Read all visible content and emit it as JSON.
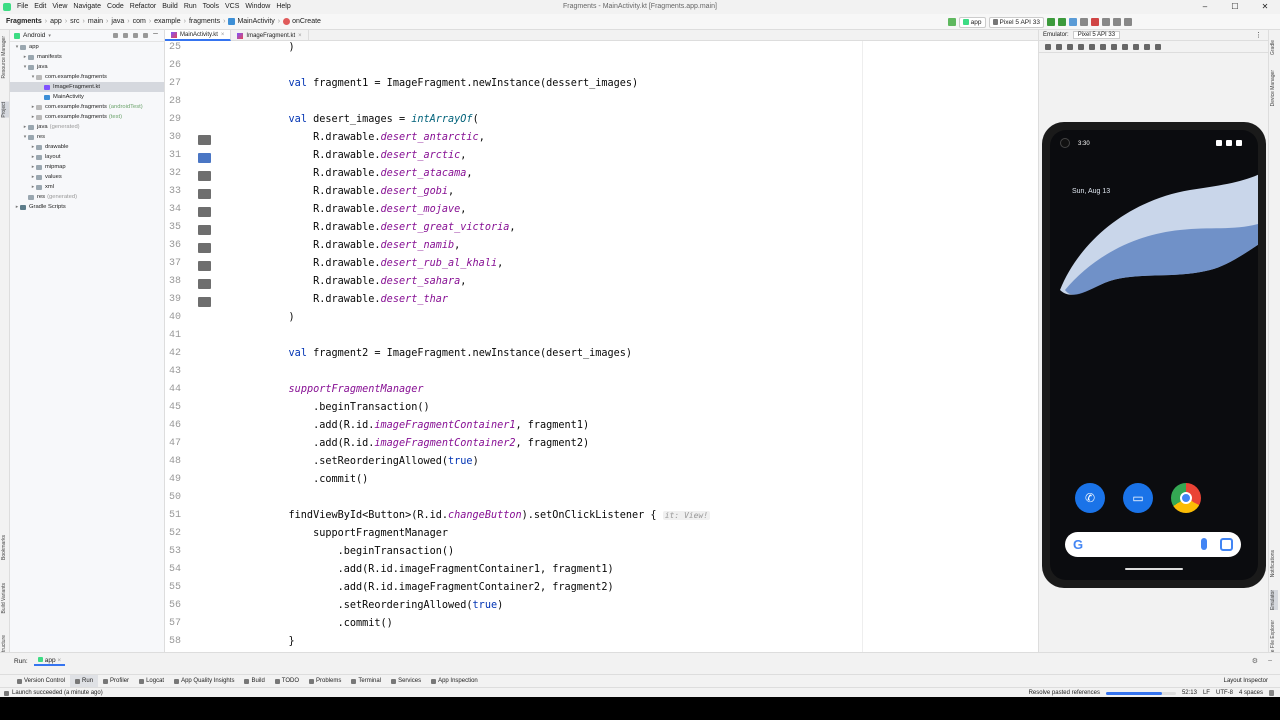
{
  "window": {
    "title": "Fragments - MainActivity.kt [Fragments.app.main]",
    "menu": [
      "File",
      "Edit",
      "View",
      "Navigate",
      "Code",
      "Refactor",
      "Build",
      "Run",
      "Tools",
      "VCS",
      "Window",
      "Help"
    ]
  },
  "breadcrumb": [
    "Fragments",
    "app",
    "src",
    "main",
    "java",
    "com",
    "example",
    "fragments",
    "MainActivity",
    "onCreate"
  ],
  "toolbar": {
    "run_config": "app",
    "device": "Pixel 5 API 33"
  },
  "project": {
    "view_mode": "Android",
    "tree": [
      {
        "label": "app",
        "indent": 0,
        "fold": "open",
        "icon": "folder-icon"
      },
      {
        "label": "manifests",
        "indent": 1,
        "fold": "closed",
        "icon": "folder-icon"
      },
      {
        "label": "java",
        "indent": 1,
        "fold": "open",
        "icon": "folder-icon"
      },
      {
        "label": "com.example.fragments",
        "indent": 2,
        "fold": "open",
        "icon": "package-icon"
      },
      {
        "label": "ImageFragment.kt",
        "indent": 3,
        "fold": "",
        "icon": "kotlin-file-icon",
        "selected": true
      },
      {
        "label": "MainActivity",
        "indent": 3,
        "fold": "",
        "icon": "kotlin-class-icon"
      },
      {
        "label": "com.example.fragments",
        "indent": 2,
        "fold": "closed",
        "icon": "package-icon",
        "suffix": "(androidTest)"
      },
      {
        "label": "com.example.fragments",
        "indent": 2,
        "fold": "closed",
        "icon": "package-icon",
        "suffix": "(test)"
      },
      {
        "label": "java",
        "indent": 1,
        "fold": "closed",
        "icon": "folder-icon",
        "gen": "(generated)"
      },
      {
        "label": "res",
        "indent": 1,
        "fold": "open",
        "icon": "folder-icon"
      },
      {
        "label": "drawable",
        "indent": 2,
        "fold": "closed",
        "icon": "folder-icon"
      },
      {
        "label": "layout",
        "indent": 2,
        "fold": "closed",
        "icon": "folder-icon"
      },
      {
        "label": "mipmap",
        "indent": 2,
        "fold": "closed",
        "icon": "folder-icon"
      },
      {
        "label": "values",
        "indent": 2,
        "fold": "closed",
        "icon": "folder-icon"
      },
      {
        "label": "xml",
        "indent": 2,
        "fold": "closed",
        "icon": "folder-icon"
      },
      {
        "label": "res",
        "indent": 1,
        "fold": "",
        "icon": "folder-icon",
        "gen": "(generated)"
      },
      {
        "label": "Gradle Scripts",
        "indent": 0,
        "fold": "closed",
        "icon": "gradle-icon"
      }
    ],
    "side_tabs": [
      "Resource Manager",
      "Project",
      "Bookmarks",
      "Build Variants",
      "Structure"
    ]
  },
  "editor_tabs": [
    {
      "label": "MainActivity.kt",
      "active": true
    },
    {
      "label": "ImageFragment.kt",
      "active": false
    }
  ],
  "code_lines": [
    {
      "n": "25",
      "icon": "",
      "segs": [
        [
          "",
          "    )"
        ]
      ]
    },
    {
      "n": "26",
      "icon": "",
      "segs": []
    },
    {
      "n": "27",
      "icon": "",
      "segs": [
        [
          "",
          "    "
        ],
        [
          "kw",
          "val"
        ],
        [
          "",
          " fragment1 = ImageFragment.newInstance(dessert_images)"
        ]
      ]
    },
    {
      "n": "28",
      "icon": "",
      "segs": []
    },
    {
      "n": "29",
      "icon": "",
      "segs": [
        [
          "",
          "    "
        ],
        [
          "kw",
          "val"
        ],
        [
          "",
          " desert_images = "
        ],
        [
          "fn",
          "intArrayOf"
        ],
        [
          "",
          "("
        ]
      ]
    },
    {
      "n": "30",
      "icon": "image",
      "segs": [
        [
          "",
          "        R.drawable."
        ],
        [
          "it",
          "desert_antarctic"
        ],
        [
          "",
          ","
        ]
      ]
    },
    {
      "n": "31",
      "icon": "blue",
      "segs": [
        [
          "",
          "        R.drawable."
        ],
        [
          "it",
          "desert_arctic"
        ],
        [
          "",
          ","
        ]
      ]
    },
    {
      "n": "32",
      "icon": "image",
      "segs": [
        [
          "",
          "        R.drawable."
        ],
        [
          "it",
          "desert_atacama"
        ],
        [
          "",
          ","
        ]
      ]
    },
    {
      "n": "33",
      "icon": "image",
      "segs": [
        [
          "",
          "        R.drawable."
        ],
        [
          "it",
          "desert_gobi"
        ],
        [
          "",
          ","
        ]
      ]
    },
    {
      "n": "34",
      "icon": "image",
      "segs": [
        [
          "",
          "        R.drawable."
        ],
        [
          "it",
          "desert_mojave"
        ],
        [
          "",
          ","
        ]
      ]
    },
    {
      "n": "35",
      "icon": "image",
      "segs": [
        [
          "",
          "        R.drawable."
        ],
        [
          "it",
          "desert_great_victoria"
        ],
        [
          "",
          ","
        ]
      ]
    },
    {
      "n": "36",
      "icon": "image",
      "segs": [
        [
          "",
          "        R.drawable."
        ],
        [
          "it",
          "desert_namib"
        ],
        [
          "",
          ","
        ]
      ]
    },
    {
      "n": "37",
      "icon": "image",
      "segs": [
        [
          "",
          "        R.drawable."
        ],
        [
          "it",
          "desert_rub_al_khali"
        ],
        [
          "",
          ","
        ]
      ]
    },
    {
      "n": "38",
      "icon": "image",
      "segs": [
        [
          "",
          "        R.drawable."
        ],
        [
          "it",
          "desert_sahara"
        ],
        [
          "",
          ","
        ]
      ]
    },
    {
      "n": "39",
      "icon": "image",
      "segs": [
        [
          "",
          "        R.drawable."
        ],
        [
          "it",
          "desert_thar"
        ]
      ]
    },
    {
      "n": "40",
      "icon": "",
      "segs": [
        [
          "",
          "    )"
        ]
      ]
    },
    {
      "n": "41",
      "icon": "",
      "segs": []
    },
    {
      "n": "42",
      "icon": "",
      "segs": [
        [
          "",
          "    "
        ],
        [
          "kw",
          "val"
        ],
        [
          "",
          " fragment2 = ImageFragment.newInstance(desert_images)"
        ]
      ]
    },
    {
      "n": "43",
      "icon": "",
      "segs": []
    },
    {
      "n": "44",
      "icon": "",
      "segs": [
        [
          "",
          "    "
        ],
        [
          "it",
          "supportFragmentManager"
        ]
      ]
    },
    {
      "n": "45",
      "icon": "",
      "segs": [
        [
          "",
          "        .beginTransaction()"
        ]
      ]
    },
    {
      "n": "46",
      "icon": "",
      "segs": [
        [
          "",
          "        .add(R.id."
        ],
        [
          "it",
          "imageFragmentContainer1"
        ],
        [
          "",
          ", fragment1)"
        ]
      ]
    },
    {
      "n": "47",
      "icon": "",
      "segs": [
        [
          "",
          "        .add(R.id."
        ],
        [
          "it",
          "imageFragmentContainer2"
        ],
        [
          "",
          ", fragment2)"
        ]
      ]
    },
    {
      "n": "48",
      "icon": "",
      "segs": [
        [
          "",
          "        .setReorderingAllowed("
        ],
        [
          "kw",
          "true"
        ],
        [
          "",
          ")"
        ]
      ]
    },
    {
      "n": "49",
      "icon": "",
      "segs": [
        [
          "",
          "        .commit()"
        ]
      ]
    },
    {
      "n": "50",
      "icon": "",
      "segs": []
    },
    {
      "n": "51",
      "icon": "",
      "segs": [
        [
          "",
          "    findViewById<Button>(R.id."
        ],
        [
          "it",
          "changeButton"
        ],
        [
          "",
          ").setOnClickListener { "
        ],
        [
          "hint",
          "it: View!"
        ]
      ]
    },
    {
      "n": "52",
      "icon": "",
      "segs": [
        [
          "",
          "        supportFragmentManager"
        ]
      ]
    },
    {
      "n": "53",
      "icon": "",
      "segs": [
        [
          "",
          "            .beginTransaction()"
        ]
      ]
    },
    {
      "n": "54",
      "icon": "",
      "segs": [
        [
          "",
          "            .add(R.id.imageFragmentContainer1, fragment1)"
        ]
      ]
    },
    {
      "n": "55",
      "icon": "",
      "segs": [
        [
          "",
          "            .add(R.id.imageFragmentContainer2, fragment2)"
        ]
      ]
    },
    {
      "n": "56",
      "icon": "",
      "segs": [
        [
          "",
          "            .setReorderingAllowed("
        ],
        [
          "kw",
          "true"
        ],
        [
          "",
          ")"
        ]
      ]
    },
    {
      "n": "57",
      "icon": "",
      "segs": [
        [
          "",
          "            .commit()"
        ]
      ]
    },
    {
      "n": "58",
      "icon": "",
      "segs": [
        [
          "",
          "    }"
        ]
      ]
    }
  ],
  "emulator": {
    "tab_label": "Emulator:",
    "device": "Pixel 5 API 33",
    "phone": {
      "time": "3:30",
      "date": "Sun, Aug 13",
      "apps": [
        "phone-icon",
        "messages-icon",
        "chrome-icon"
      ]
    }
  },
  "run_bar": {
    "label": "Run:",
    "config": "app"
  },
  "tool_windows": [
    {
      "label": "Version Control",
      "icon": "vcs-icon"
    },
    {
      "label": "Run",
      "icon": "run-icon",
      "active": true
    },
    {
      "label": "Profiler",
      "icon": "profiler-icon"
    },
    {
      "label": "Logcat",
      "icon": "logcat-icon"
    },
    {
      "label": "App Quality Insights",
      "icon": "insights-icon"
    },
    {
      "label": "Build",
      "icon": "build-icon"
    },
    {
      "label": "TODO",
      "icon": "todo-icon"
    },
    {
      "label": "Problems",
      "icon": "problems-icon"
    },
    {
      "label": "Terminal",
      "icon": "terminal-icon"
    },
    {
      "label": "Services",
      "icon": "services-icon"
    },
    {
      "label": "App Inspection",
      "icon": "inspection-icon"
    }
  ],
  "layout_inspector": "Layout Inspector",
  "status": {
    "message": "Launch succeeded (a minute ago)",
    "task": "Resolve pasted references",
    "progress": 0.8,
    "position": "52:13",
    "line_sep": "LF",
    "encoding": "UTF-8",
    "indent": "4 spaces"
  },
  "colors": {
    "accent": "#3574f0",
    "android_green": "#3ddc84",
    "keyword": "#0033b3",
    "property": "#871094"
  }
}
